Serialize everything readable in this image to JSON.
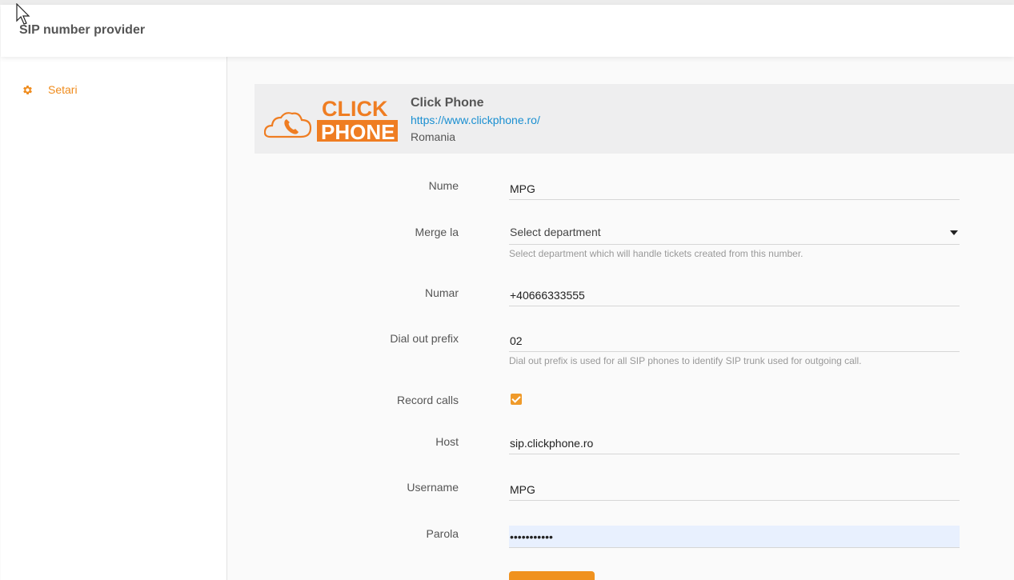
{
  "app": {
    "title": "SIP number provider"
  },
  "sidebar": {
    "items": [
      {
        "label": "Setari",
        "icon": "gear-icon"
      }
    ]
  },
  "provider": {
    "name": "Click Phone",
    "url": "https://www.clickphone.ro/",
    "country": "Romania",
    "logo": {
      "line1": "CLICK",
      "line2": "PHONE"
    }
  },
  "form": {
    "name": {
      "label": "Nume",
      "value": "MPG"
    },
    "department": {
      "label": "Merge la",
      "value": "Select department",
      "hint": "Select department which will handle tickets created from this number."
    },
    "number": {
      "label": "Numar",
      "value": "+40666333555"
    },
    "prefix": {
      "label": "Dial out prefix",
      "value": "02",
      "hint": "Dial out prefix is used for all SIP phones to identify SIP trunk used for outgoing call."
    },
    "record": {
      "label": "Record calls",
      "checked": true
    },
    "host": {
      "label": "Host",
      "value": "sip.clickphone.ro"
    },
    "username": {
      "label": "Username",
      "value": "MPG"
    },
    "password": {
      "label": "Parola",
      "value": "•••••••••••"
    }
  },
  "colors": {
    "accent": "#ef8b1c",
    "link": "#1a8fd1",
    "card": "#eeeeef"
  }
}
